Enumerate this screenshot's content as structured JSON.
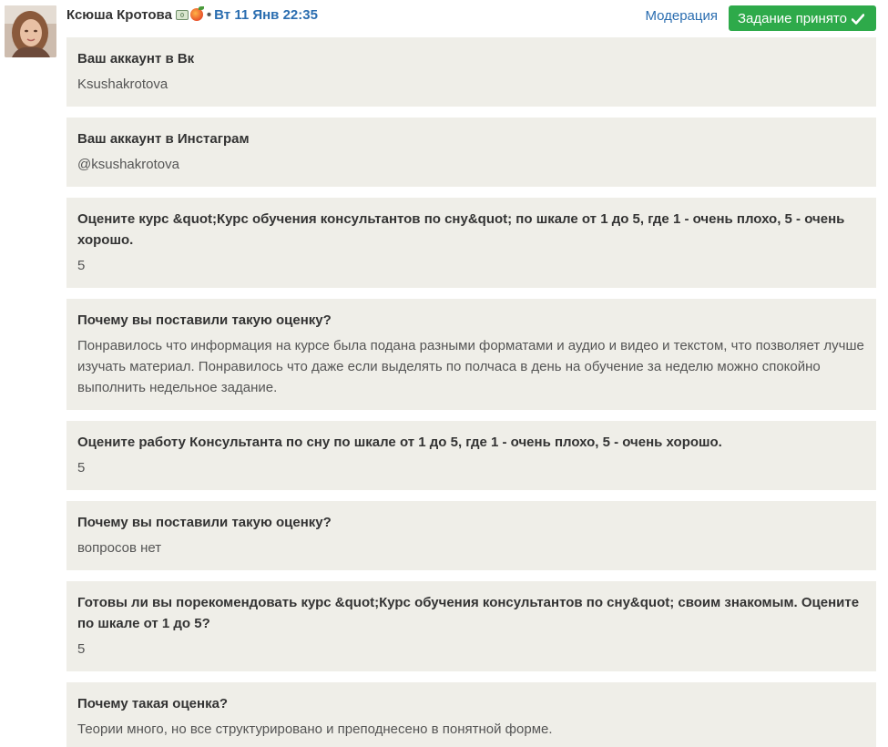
{
  "header": {
    "author_name": "Ксюша Кротова",
    "separator": "•",
    "date": "Вт 11 Янв 22:35",
    "moderation_label": "Модерация",
    "status_label": "Задание принято"
  },
  "icons": {
    "money_badge": "money-icon",
    "peach_badge": "peach-icon",
    "status_check": "check-icon"
  },
  "colors": {
    "link": "#2a6db0",
    "status_green": "#2eaa4a",
    "card_bg": "#efeee8"
  },
  "answers": [
    {
      "question": "Ваш аккаунт в Вк",
      "answer": "Ksushakrotova"
    },
    {
      "question": "Ваш аккаунт в Инстаграм",
      "answer": "@ksushakrotova"
    },
    {
      "question": "Оцените курс &quot;Курс обучения консультантов по сну&quot; по шкале от 1 до 5, где 1 - очень плохо, 5 - очень хорошо.",
      "answer": "5"
    },
    {
      "question": "Почему вы поставили такую оценку?",
      "answer": "Понравилось что информация на курсе была подана разными форматами и аудио и видео и текстом, что позволяет лучше изучать материал. Понравилось что даже если выделять по полчаса в день на обучение за неделю можно спокойно выполнить недельное задание."
    },
    {
      "question": "Оцените работу Консультанта по сну по шкале от 1 до 5, где 1 - очень плохо, 5 - очень хорошо.",
      "answer": "5"
    },
    {
      "question": "Почему вы поставили такую оценку?",
      "answer": "вопросов нет"
    },
    {
      "question": "Готовы ли вы порекомендовать курс &quot;Курс обучения консультантов по сну&quot; своим знакомым. Оцените по шкале от 1 до 5?",
      "answer": "5"
    },
    {
      "question": "Почему такая оценка?",
      "answer": "Теории много, но все структурировано и преподнесено в понятной форме."
    }
  ]
}
